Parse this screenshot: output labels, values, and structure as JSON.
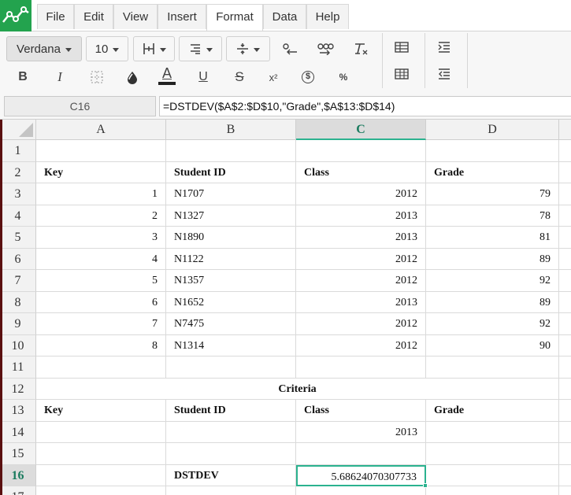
{
  "menu": {
    "items": [
      "File",
      "Edit",
      "View",
      "Insert",
      "Format",
      "Data",
      "Help"
    ],
    "active": "Format"
  },
  "toolbar": {
    "font_name": "Verdana",
    "font_size": "10",
    "bold_label": "B",
    "italic_label": "I",
    "text_color_label": "A",
    "underline_label": "U",
    "strike_label": "S",
    "superscript_label": "x²",
    "currency_label": "$",
    "percent_label": "%"
  },
  "formula_bar": {
    "cell_ref": "C16",
    "formula": "=DSTDEV($A$2:$D$10,\"Grade\",$A$13:$D$14)"
  },
  "columns": [
    "A",
    "B",
    "C",
    "D"
  ],
  "selected_column": "C",
  "rows": [
    "1",
    "2",
    "3",
    "4",
    "5",
    "6",
    "7",
    "8",
    "9",
    "10",
    "11",
    "12",
    "13",
    "14",
    "15",
    "16",
    "17"
  ],
  "selected_row": "16",
  "cells": {
    "r2": {
      "a": "Key",
      "b": "Student ID",
      "c": "Class",
      "d": "Grade"
    },
    "r3": {
      "a": "1",
      "b": "N1707",
      "c": "2012",
      "d": "79"
    },
    "r4": {
      "a": "2",
      "b": "N1327",
      "c": "2013",
      "d": "78"
    },
    "r5": {
      "a": "3",
      "b": "N1890",
      "c": "2013",
      "d": "81"
    },
    "r6": {
      "a": "4",
      "b": "N1122",
      "c": "2012",
      "d": "89"
    },
    "r7": {
      "a": "5",
      "b": "N1357",
      "c": "2012",
      "d": "92"
    },
    "r8": {
      "a": "6",
      "b": "N1652",
      "c": "2013",
      "d": "89"
    },
    "r9": {
      "a": "7",
      "b": "N7475",
      "c": "2012",
      "d": "92"
    },
    "r10": {
      "a": "8",
      "b": "N1314",
      "c": "2012",
      "d": "90"
    },
    "r12": {
      "merged": "Criteria"
    },
    "r13": {
      "a": "Key",
      "b": "Student ID",
      "c": "Class",
      "d": "Grade"
    },
    "r14": {
      "c": "2013"
    },
    "r16": {
      "b": "DSTDEV",
      "c": "5.68624070307733"
    }
  },
  "colors": {
    "accent": "#2bb28f",
    "logo": "#23a34e"
  }
}
